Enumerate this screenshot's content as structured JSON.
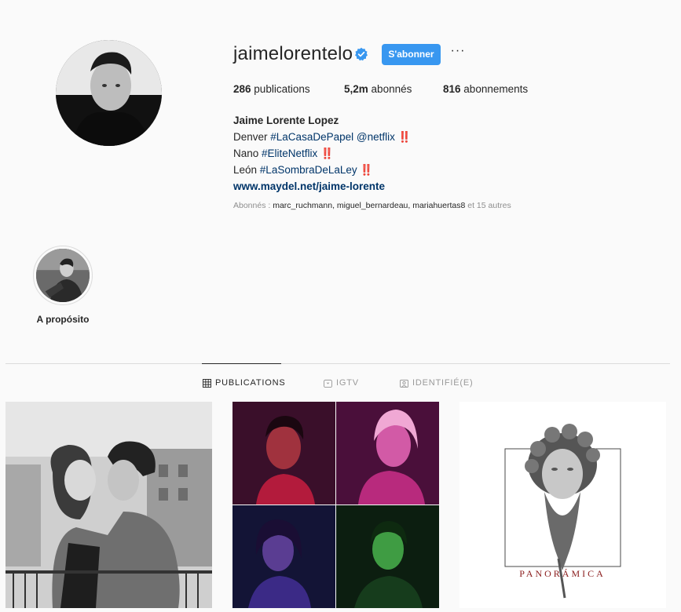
{
  "profile": {
    "username": "jaimelorentelo",
    "follow_label": "S'abonner",
    "more_label": "···",
    "stats": {
      "posts_count": "286",
      "posts_label": "publications",
      "followers_count": "5,2m",
      "followers_label": "abonnés",
      "following_count": "816",
      "following_label": "abonnements"
    },
    "bio": {
      "name": "Jaime Lorente Lopez",
      "line1_prefix": "Denver ",
      "line1_tag": "#LaCasaDePapel",
      "line1_mention": "@netflix",
      "line1_suffix": " ‼️",
      "line2_prefix": "Nano ",
      "line2_tag": "#EliteNetflix",
      "line2_suffix": " ‼️",
      "line3_prefix": "León ",
      "line3_tag": "#LaSombraDeLaLey",
      "line3_suffix": " ‼️",
      "website": "www.maydel.net/jaime-lorente"
    },
    "followed_by": {
      "prefix": "Abonnés : ",
      "names": "marc_ruchmann, miguel_bernardeau, mariahuertas8",
      "suffix": " et 15 autres"
    }
  },
  "highlights": [
    {
      "label": "A propósito"
    }
  ],
  "tabs": [
    {
      "label": "PUBLICATIONS",
      "icon": "grid-icon",
      "active": true
    },
    {
      "label": "IGTV",
      "icon": "igtv-icon",
      "active": false
    },
    {
      "label": "IDENTIFIÉ(E)",
      "icon": "tagged-icon",
      "active": false
    }
  ],
  "posts": [
    {
      "description_icon": "couple-photo"
    },
    {
      "description_icon": "elite-cast-collage"
    },
    {
      "text": "PANORÁMICA"
    }
  ],
  "colors": {
    "accent": "#3897f0",
    "link": "#003569",
    "muted": "#8e8e8e",
    "text": "#262626",
    "background": "#fafafa"
  }
}
